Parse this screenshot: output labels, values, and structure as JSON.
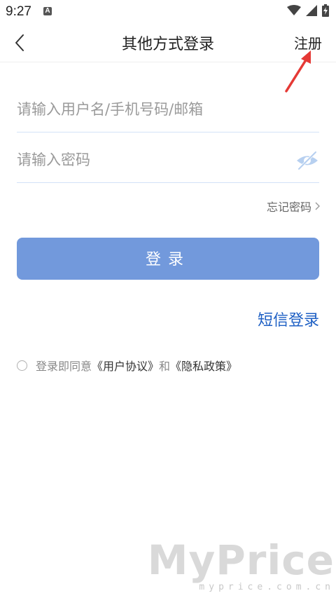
{
  "status_bar": {
    "time": "9:27",
    "notification_icon": "a-notification-icon",
    "icons": [
      "wifi-icon",
      "signal-icon",
      "battery-charging-icon"
    ]
  },
  "nav": {
    "back_icon": "chevron-left-icon",
    "title": "其他方式登录",
    "register_label": "注册"
  },
  "form": {
    "username_placeholder": "请输入用户名/手机号码/邮箱",
    "username_value": "",
    "password_placeholder": "请输入密码",
    "password_value": "",
    "password_visibility_icon": "eye-hidden-icon",
    "forgot_label": "忘记密码",
    "forgot_icon": "chevron-right-icon",
    "login_label": "登录",
    "sms_login_label": "短信登录"
  },
  "agreement": {
    "prefix": "登录即同意",
    "user_agreement": "《用户协议》",
    "joiner": "和",
    "privacy_policy": "《隐私政策》",
    "checked": false
  },
  "annotation": {
    "arrow_color": "#e53935"
  },
  "colors": {
    "accent": "#7299dc",
    "link": "#1d5fc4",
    "divider": "#d3e2f7"
  },
  "watermark": {
    "brand": "MyPrice",
    "domain": "myprice.com.cn"
  }
}
